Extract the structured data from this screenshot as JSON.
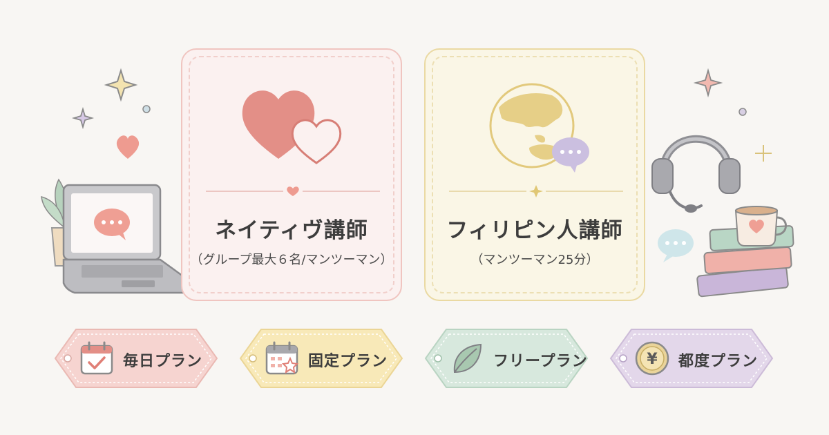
{
  "cards": [
    {
      "title": "ネイティヴ講師",
      "subtitle": "（グループ最大６名/マンツーマン）"
    },
    {
      "title": "フィリピン人講師",
      "subtitle": "（マンツーマン25分）"
    }
  ],
  "plans": [
    {
      "label": "毎日プラン",
      "icon": "calendar-check-icon",
      "color": "#f6d4d0"
    },
    {
      "label": "固定プラン",
      "icon": "calendar-star-icon",
      "color": "#f8e9b8"
    },
    {
      "label": "フリープラン",
      "icon": "leaf-icon",
      "color": "#d7e8dd"
    },
    {
      "label": "都度プラン",
      "icon": "yen-coin-icon",
      "color": "#e3d7ea"
    }
  ],
  "yen_symbol": "¥"
}
